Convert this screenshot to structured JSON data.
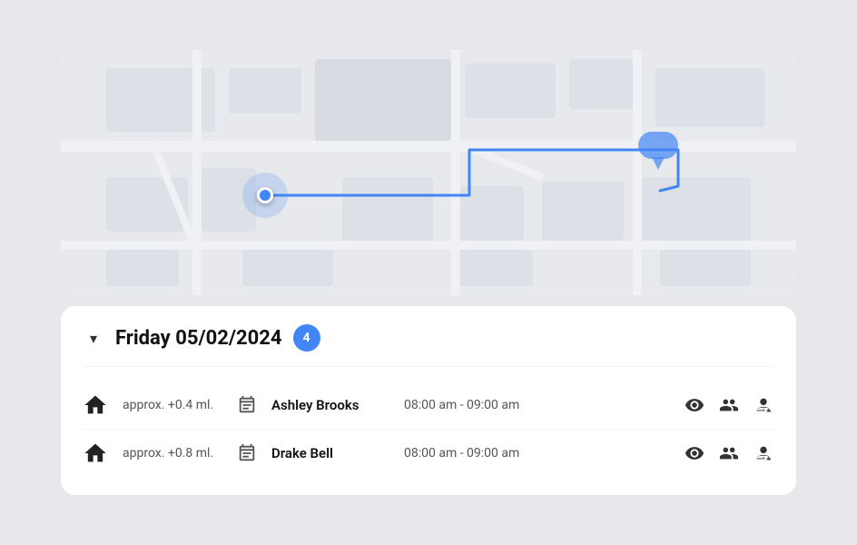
{
  "map": {
    "alt": "Map showing route"
  },
  "schedule": {
    "chevron": "▾",
    "date_label": "Friday 05/02/2024",
    "count": "4",
    "rows": [
      {
        "distance": "approx. +0.4 ml.",
        "name": "Ashley Brooks",
        "time": "08:00 am - 09:00 am"
      },
      {
        "distance": "approx. +0.8 ml.",
        "name": "Drake Bell",
        "time": "08:00 am - 09:00 am"
      }
    ]
  }
}
